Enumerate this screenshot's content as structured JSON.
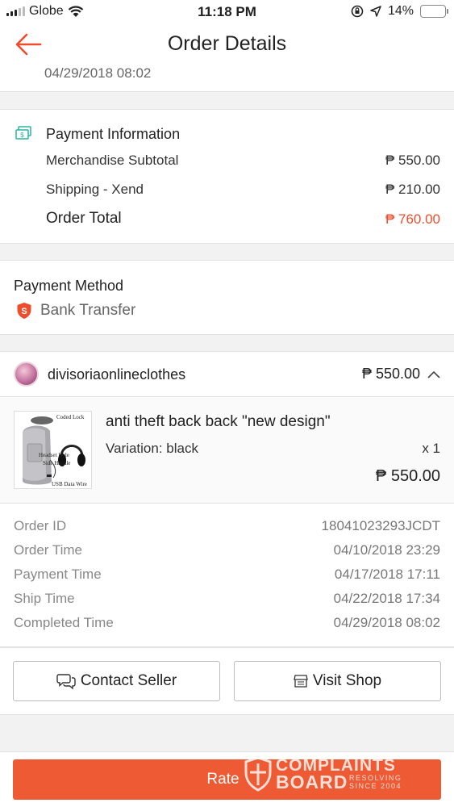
{
  "status_bar": {
    "carrier": "Globe",
    "time": "11:18 PM",
    "battery": "14%",
    "battery_level": 0.14
  },
  "header": {
    "title": "Order Details",
    "back_icon": "arrow-left-icon"
  },
  "shipping": {
    "completed_timestamp_partial": "04/29/2018 08:02"
  },
  "payment_info": {
    "title": "Payment Information",
    "icon": "money-icon",
    "rows": [
      {
        "label": "Merchandise Subtotal",
        "value": "₱ 550.00"
      },
      {
        "label": "Shipping - Xend",
        "value": "₱ 210.00"
      }
    ],
    "total_label": "Order Total",
    "total_value": "₱ 760.00"
  },
  "payment_method": {
    "title": "Payment Method",
    "icon": "shield-s-icon",
    "value": "Bank Transfer"
  },
  "shop": {
    "name": "divisoriaonlineclothes",
    "total": "₱ 550.00",
    "product": {
      "name": "anti theft back back \"new design\"",
      "variation": "Variation: black",
      "quantity": "x 1",
      "price": "₱ 550.00",
      "thumb_labels": [
        "Coded Lock",
        "Headset Hole",
        "Side Handle",
        "USB Data Wire"
      ]
    },
    "meta": [
      {
        "label": "Order ID",
        "value": "18041023293JCDT"
      },
      {
        "label": "Order Time",
        "value": "04/10/2018 23:29"
      },
      {
        "label": "Payment Time",
        "value": "04/17/2018 17:11"
      },
      {
        "label": "Ship Time",
        "value": "04/22/2018 17:34"
      },
      {
        "label": "Completed Time",
        "value": "04/29/2018 08:02"
      }
    ]
  },
  "actions": {
    "contact_seller": "Contact Seller",
    "visit_shop": "Visit Shop",
    "rate": "Rate"
  },
  "watermark": {
    "line1": "COMPLAINTS",
    "line2": "BOARD",
    "line3a": "RESOLVING",
    "line3b": "SINCE 2004"
  },
  "colors": {
    "accent": "#ee4d2d",
    "rate_button": "#ee5a33",
    "payment_icon": "#2bb3a3"
  }
}
